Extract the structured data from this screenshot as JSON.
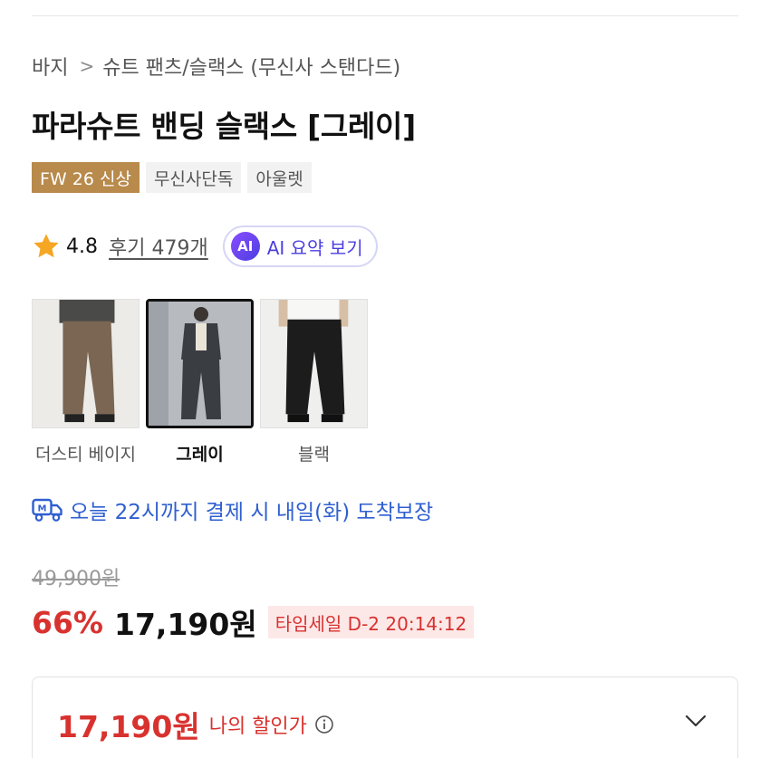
{
  "breadcrumb": {
    "category": "바지",
    "separator": ">",
    "subcategory": "슈트 팬츠/슬랙스 (무신사 스탠다드)"
  },
  "product": {
    "title": "파라슈트 밴딩 슬랙스 [그레이]"
  },
  "badges": [
    {
      "label": "FW 26 신상"
    },
    {
      "label": "무신사단독"
    },
    {
      "label": "아울렛"
    }
  ],
  "rating": {
    "value": "4.8",
    "review_link": "후기 479개",
    "ai_badge": "AI",
    "ai_summary_label": "AI 요약 보기"
  },
  "colors": [
    {
      "name": "더스티 베이지",
      "selected": false,
      "pants_color": "#7a6652"
    },
    {
      "name": "그레이",
      "selected": true,
      "pants_color": "#3a3d42"
    },
    {
      "name": "블랙",
      "selected": false,
      "pants_color": "#1c1c1c"
    }
  ],
  "delivery": {
    "text": "오늘 22시까지 결제 시 내일(화) 도착보장",
    "color": "#2f5fd0"
  },
  "price": {
    "original": "49,900원",
    "discount_rate": "66%",
    "sale": "17,190원",
    "timesale": "타임세일 D-2 20:14:12"
  },
  "my_price": {
    "price": "17,190원",
    "label": "나의 할인가"
  },
  "theme": {
    "accent_red": "#d8322f",
    "badge_new_bg": "#b88a4c",
    "ai_purple": "#4b3fe0"
  }
}
